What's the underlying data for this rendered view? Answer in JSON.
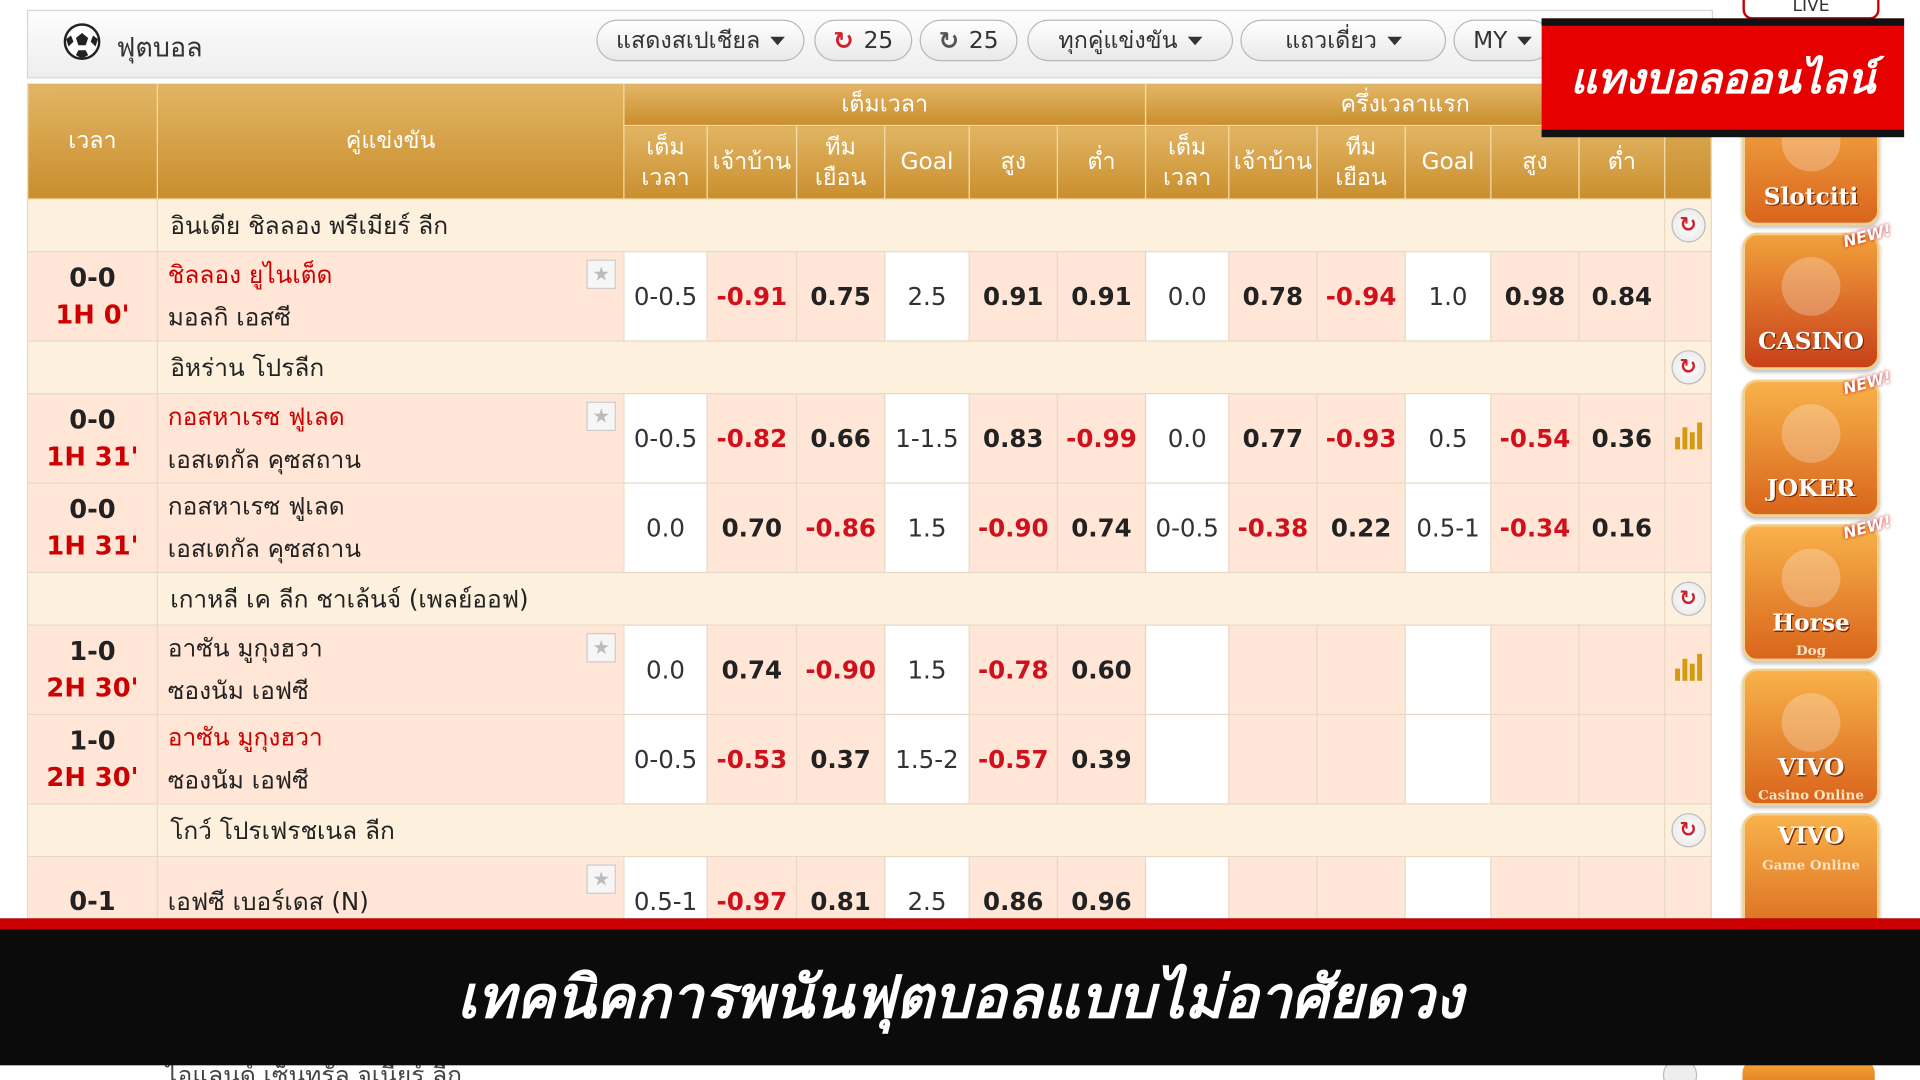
{
  "topbar": {
    "title": "ฟุตบอล",
    "special_label": "แสดงสเปเชียล",
    "refresh1": "25",
    "refresh2": "25",
    "matches_filter": "ทุกคู่แข่งขัน",
    "view_label": "แถวเดี่ยว",
    "odds_type": "MY"
  },
  "headers": {
    "time": "เวลา",
    "match": "คู่แข่งขัน",
    "full_time": "เต็มเวลา",
    "first_half": "ครึ่งเวลาแรก",
    "cols": [
      "เต็ม เวลา",
      "เจ้าบ้าน",
      "ทีม เยือน",
      "Goal",
      "สูง",
      "ต่ำ"
    ]
  },
  "leagues": [
    {
      "name": "อินเดีย ชิลลอง พรีเมียร์ ลีก"
    },
    {
      "name": "อิหร่าน โปรลีก"
    },
    {
      "name": "เกาหลี เค ลีก ชาเล้นจ์ (เพลย์ออฟ)"
    },
    {
      "name": "โกว์ โปรเฟรชเนล ลีก"
    }
  ],
  "matches": [
    {
      "score": "0-0",
      "clock": "1H 0'",
      "home": "ชิลลอง ยูไนเต็ด",
      "away": "มอลกิ เอสซี",
      "ft": [
        "0-0.5",
        "-0.91",
        "0.75",
        "2.5",
        "0.91",
        "0.91"
      ],
      "fh": [
        "0.0",
        "0.78",
        "-0.94",
        "1.0",
        "0.98",
        "0.84"
      ]
    },
    {
      "score": "0-0",
      "clock": "1H 31'",
      "home": "กอสหาเรซ ฟูเลด",
      "away": "เอสเตกัล คุซสถาน",
      "ft": [
        "0-0.5",
        "-0.82",
        "0.66",
        "1-1.5",
        "0.83",
        "-0.99"
      ],
      "fh": [
        "0.0",
        "0.77",
        "-0.93",
        "0.5",
        "-0.54",
        "0.36"
      ]
    },
    {
      "score": "0-0",
      "clock": "1H 31'",
      "home": "กอสหาเรซ ฟูเลด",
      "away": "เอสเตกัล คุซสถาน",
      "ft": [
        "0.0",
        "0.70",
        "-0.86",
        "1.5",
        "-0.90",
        "0.74"
      ],
      "fh": [
        "0-0.5",
        "-0.38",
        "0.22",
        "0.5-1",
        "-0.34",
        "0.16"
      ]
    },
    {
      "score": "1-0",
      "clock": "2H 30'",
      "home": "อาซัน มูกุงฮวา",
      "away": "ซองนัม เอฟซี",
      "ft": [
        "0.0",
        "0.74",
        "-0.90",
        "1.5",
        "-0.78",
        "0.60"
      ],
      "fh": [
        "",
        "",
        "",
        "",
        "",
        ""
      ]
    },
    {
      "score": "1-0",
      "clock": "2H 30'",
      "home": "อาซัน มูกุงฮวา",
      "away": "ซองนัม เอฟซี",
      "ft": [
        "0-0.5",
        "-0.53",
        "0.37",
        "1.5-2",
        "-0.57",
        "0.39"
      ],
      "fh": [
        "",
        "",
        "",
        "",
        "",
        ""
      ]
    },
    {
      "score": "0-1",
      "clock": "",
      "home": "เอฟซี เบอร์เดส (N)",
      "away": "",
      "ft": [
        "0.5-1",
        "-0.97",
        "0.81",
        "2.5",
        "0.86",
        "0.96"
      ],
      "fh": [
        "",
        "",
        "",
        "",
        "",
        ""
      ]
    }
  ],
  "sidebar": {
    "live_label": "LIVE",
    "new_badge": "NEW!",
    "tiles": [
      {
        "label": "Slotciti",
        "sub": ""
      },
      {
        "label": "CASINO",
        "sub": ""
      },
      {
        "label": "JOKER",
        "sub": ""
      },
      {
        "label": "Horse",
        "sub": "Dog"
      },
      {
        "label": "VIVO",
        "sub": "Casino Online"
      },
      {
        "label": "VIVO",
        "sub": "Game Online"
      }
    ]
  },
  "overlays": {
    "red_banner": "แทงบอลออนไลน์",
    "bottom_title": "เทคนิคการพนันฟุตบอลแบบไม่อาศัยดวง",
    "peek_text": "ไอแลนด์ เซ็นทรัล จูเนียร์ ลีก"
  },
  "colors": {
    "header_gold": "#c98e2d",
    "row_pink": "#ffe6d6",
    "league_row": "#fdf0dd",
    "negative_odds": "#d0101a",
    "banner_red": "#e60000",
    "bottom_bar": "#0b0b0b"
  }
}
